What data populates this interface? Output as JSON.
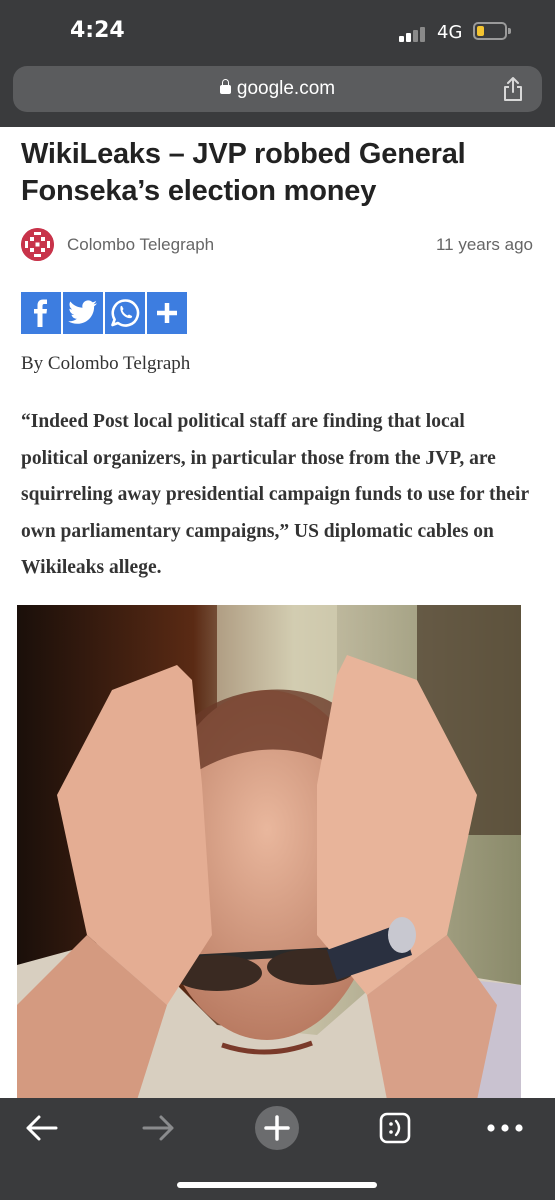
{
  "status_bar": {
    "time": "4:24",
    "network": "4G"
  },
  "browser": {
    "url": "google.com"
  },
  "article": {
    "title": "WikiLeaks – JVP robbed General Fonseka’s election money",
    "source": "Colombo Telegraph",
    "age": "11 years ago",
    "byline": "By Colombo Telgraph",
    "quote": "“Indeed Post local political staff are finding that local political organizers, in particular those from the JVP, are squirreling away presidential campaign funds to use for their own parliamentary campaigns,” US diplomatic cables on Wikileaks allege."
  },
  "share_buttons": [
    "facebook-icon",
    "twitter-icon",
    "whatsapp-icon",
    "plus-icon"
  ],
  "toolbar": [
    "back-icon",
    "forward-icon",
    "new-tab-icon",
    "tabs-icon",
    "more-icon"
  ],
  "colors": {
    "chrome": "#3a3b3d",
    "share_blue": "#3d7de0",
    "battery": "#f4c430"
  }
}
